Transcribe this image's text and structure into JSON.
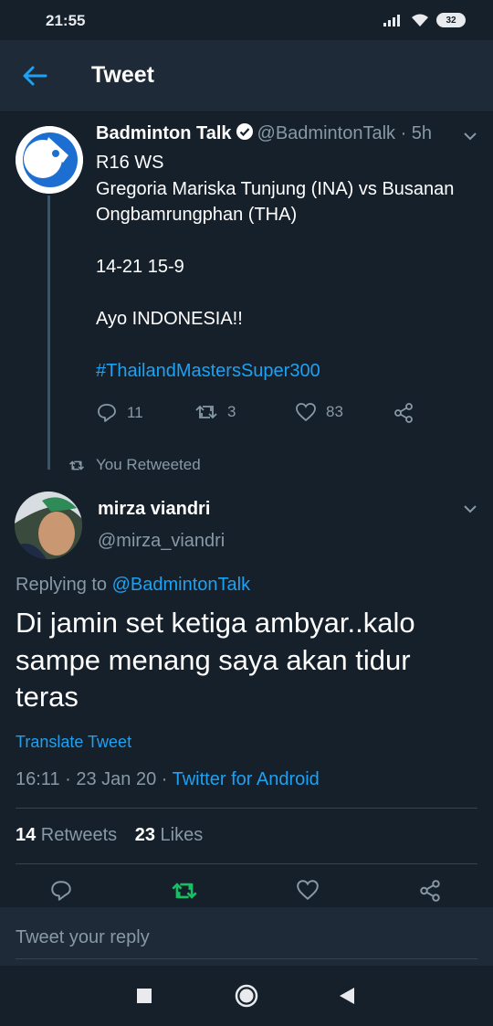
{
  "status_bar": {
    "time": "21:55",
    "battery": "32"
  },
  "header": {
    "title": "Tweet"
  },
  "original_tweet": {
    "name": "Badminton Talk",
    "handle": "@BadmintonTalk",
    "separator": " · ",
    "age": "5h",
    "lines": [
      "R16 WS",
      "Gregoria Mariska Tunjung (INA) vs Busanan",
      "Ongbamrungphan (THA)",
      "",
      "14-21 15-9",
      "",
      "Ayo INDONESIA!!",
      ""
    ],
    "hashtag": "#ThailandMastersSuper300",
    "replies": "11",
    "retweets": "3",
    "likes": "83"
  },
  "retweet_label": "You Retweeted",
  "reply_tweet": {
    "name": "mirza viandri",
    "handle": "@mirza_viandri",
    "replying_prefix": "Replying to ",
    "replying_to": "@BadmintonTalk",
    "text": "Di jamin set ketiga ambyar..kalo sampe menang saya akan tidur teras",
    "translate": "Translate Tweet",
    "timestamp": "16:11 · 23 Jan 20 · ",
    "app": "Twitter for Android",
    "retweets_count": "14",
    "retweets_label": " Retweets",
    "likes_count": "23",
    "likes_label": " Likes"
  },
  "reply_box": {
    "placeholder": "Tweet your reply"
  },
  "colors": {
    "background": "#15202b",
    "accent": "#1da1f2",
    "retweet_active": "#17bf63",
    "muted": "#8899a6"
  }
}
